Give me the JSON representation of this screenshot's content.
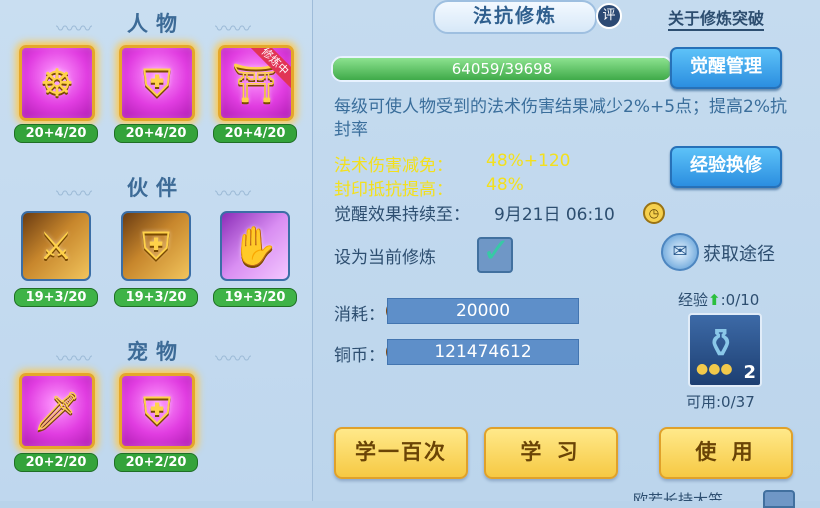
{
  "sections": {
    "character": "人物",
    "partner": "伙伴",
    "pet": "宠物"
  },
  "character_cards": [
    {
      "glyph": "☸",
      "level": "20+4/20",
      "badge": ""
    },
    {
      "glyph": "⛨",
      "level": "20+4/20",
      "badge": ""
    },
    {
      "glyph": "⛩",
      "level": "20+4/20",
      "badge": "修炼中"
    }
  ],
  "partner_cards": [
    {
      "glyph": "⚔",
      "level": "19+3/20"
    },
    {
      "glyph": "⛨",
      "level": "19+3/20"
    },
    {
      "glyph": "✋",
      "level": "19+3/20"
    }
  ],
  "pet_cards": [
    {
      "glyph": "🗡",
      "level": "20+2/20"
    },
    {
      "glyph": "⛨",
      "level": "20+2/20"
    }
  ],
  "header": {
    "title": "法抗修炼",
    "rate_badge": "评",
    "about_link": "关于修炼突破"
  },
  "progress": {
    "text": "64059/39698",
    "fill_fraction": 1.0
  },
  "buttons": {
    "awaken_manage": "觉醒管理",
    "exp_exchange": "经验换修",
    "learn_100": "学一百次",
    "learn": "学 习",
    "use": "使 用"
  },
  "description": "每级可使人物受到的法术伤害结果减少2%+5点；提高2%抗封率",
  "stats": [
    {
      "label": "法术伤害减免：",
      "value": "48%+120"
    },
    {
      "label": "封印抵抗提高：",
      "value": "48%"
    }
  ],
  "awaken": {
    "label": "觉醒效果持续至：",
    "value": "9月21日 06:10"
  },
  "set_current": "设为当前修炼",
  "obtain_path": "获取途径",
  "cost": {
    "label": "消耗：",
    "value": "20000"
  },
  "copper": {
    "label": "铜币：",
    "value": "121474612"
  },
  "item": {
    "exp_label": "经验",
    "exp_value": ":0/10",
    "count": "2",
    "available": "可用:0/37"
  },
  "bottom_cut_text": "欧若长持大笠",
  "colors": {
    "accent_yellow": "#f3e01d",
    "text_blue": "#3a6e9b",
    "gauge_green": "#3faa49"
  }
}
